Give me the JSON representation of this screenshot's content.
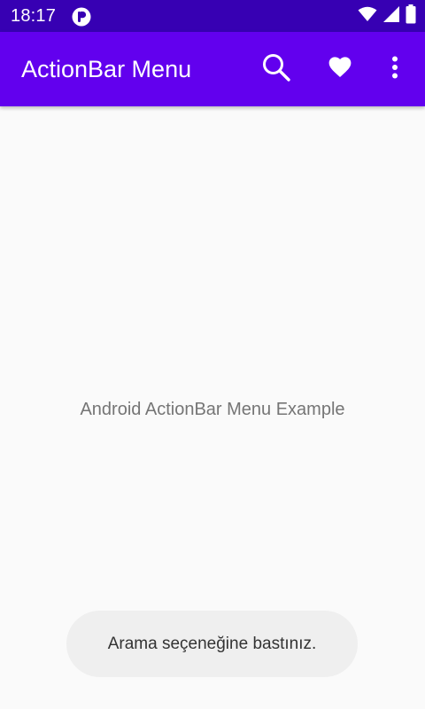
{
  "status_bar": {
    "time": "18:17",
    "app_icon": "app-notification-icon",
    "icons": [
      "wifi-icon",
      "signal-icon",
      "battery-icon"
    ],
    "background": "#3700b3"
  },
  "action_bar": {
    "title": "ActionBar Menu",
    "background": "#6200ee",
    "actions": [
      {
        "name": "search",
        "icon": "search-icon"
      },
      {
        "name": "favorite",
        "icon": "heart-icon"
      },
      {
        "name": "overflow",
        "icon": "more-vert-icon"
      }
    ]
  },
  "content": {
    "message": "Android ActionBar Menu Example"
  },
  "toast": {
    "text": "Arama seçeneğine bastınız."
  }
}
